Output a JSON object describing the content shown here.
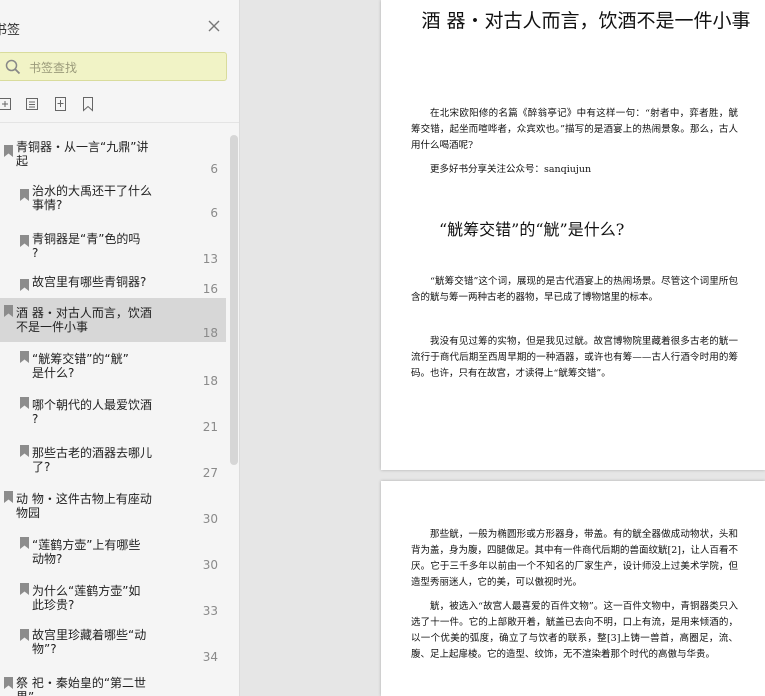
{
  "sidebar": {
    "title": "书签",
    "search_placeholder": "书签查找",
    "items": [
      {
        "label": "青铜器・从一言“九鼎”讲\n起",
        "page": "6"
      },
      {
        "label": "治水的大禹还干了什么\n事情?",
        "page": "6"
      },
      {
        "label": "青铜器是“青”色的吗\n?",
        "page": "13"
      },
      {
        "label": "故宫里有哪些青铜器?",
        "page": "16"
      },
      {
        "label": "酒 器・对古人而言，饮酒\n不是一件小事",
        "page": "18"
      },
      {
        "label": "“觥筹交错”的“觥”\n是什么?",
        "page": "18"
      },
      {
        "label": "哪个朝代的人最爱饮酒\n?",
        "page": "21"
      },
      {
        "label": "那些古老的酒器去哪儿\n了?",
        "page": "27"
      },
      {
        "label": "动 物・这件古物上有座动\n物园",
        "page": "30"
      },
      {
        "label": "“莲鹤方壶”上有哪些\n动物?",
        "page": "30"
      },
      {
        "label": "为什么“莲鹤方壶”如\n此珍贵?",
        "page": "33"
      },
      {
        "label": "故宫里珍藏着哪些“动\n物”?",
        "page": "34"
      },
      {
        "label": "祭 祀・秦始皇的“第二世\n界”",
        "page": ""
      }
    ]
  },
  "page1": {
    "heading": "酒 器・对古人而言，饮酒不是一件小事",
    "para1": "在北宋欧阳修的名篇《醉翁亭记》中有这样一句：“射者中，弈者胜，觥筹交错，起坐而喧哗者，众宾欢也。”描写的是酒宴上的热闹景象。那么，古人用什么喝酒呢?",
    "para2": "更多好书分享关注公众号：sanqiujun",
    "subheading": "“觥筹交错”的“觥”是什么?",
    "para3": "“觥筹交错”这个词，展现的是古代酒宴上的热闹场景。尽管这个词里所包含的觥与筹一两种古老的器物，早已成了博物馆里的标本。",
    "para4": "我没有见过筹的实物，但是我见过觥。故宫博物院里藏着很多古老的觥一流行于商代后期至西周早期的一种酒器，或许也有筹——古人行酒令时用的筹码。也许，只有在故宫，才读得上“觥筹交错”。"
  },
  "page2": {
    "para1": "那些觥，一般为椭圆形或方形器身，带盖。有的觥全器做成动物状，头和背为盖，身为腹，四腿做足。其中有一件商代后期的兽面纹觥[2]，让人百看不厌。它于三千多年以前由一个不知名的厂家生产，设计师没上过美术学院，但造型秀丽迷人，它的美，可以傲视时光。",
    "para2": "觥，被选入“故宫人最喜爱的百件文物”。这一百件文物中，青铜器类只入选了十一件。它的上部敞开着，觥盖已去向不明，口上有流，是用来倾酒的，以一个优美的弧度，确立了与饮者的联系，整[3]上铸一兽首，高圈足，流、腹、足上起扉棱。它的造型、纹饰，无不渲染着那个时代的高傲与华贵。"
  }
}
